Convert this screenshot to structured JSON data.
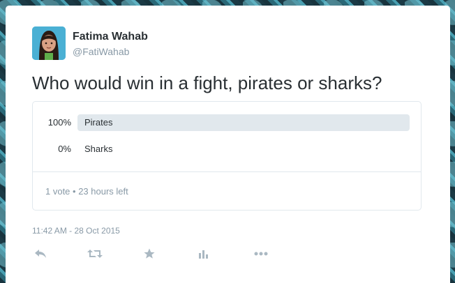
{
  "user": {
    "name": "Fatima Wahab",
    "handle": "@FatiWahab",
    "avatar_icon": "avatar-woman-icon"
  },
  "tweet": {
    "text": "Who would win in a fight, pirates or sharks?"
  },
  "poll": {
    "choices": [
      {
        "label": "Pirates",
        "percent_text": "100%",
        "percent": 100
      },
      {
        "label": "Sharks",
        "percent_text": "0%",
        "percent": 0
      }
    ],
    "meta": "1 vote • 23 hours left"
  },
  "timestamp": "11:42 AM - 28 Oct 2015",
  "actions": [
    {
      "name": "reply-icon"
    },
    {
      "name": "retweet-icon"
    },
    {
      "name": "favorite-star-icon"
    },
    {
      "name": "analytics-icon"
    },
    {
      "name": "more-icon"
    }
  ],
  "colors": {
    "text": "#292f33",
    "muted": "#8899a6",
    "border": "#e1e8ed",
    "bar": "#e1e8ed",
    "action_icon": "#aab8c2"
  }
}
